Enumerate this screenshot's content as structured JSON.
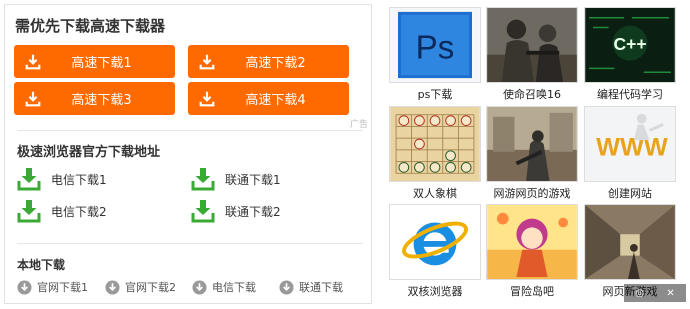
{
  "fast_download": {
    "title": "需优先下载高速下载器",
    "buttons": [
      "高速下载1",
      "高速下载2",
      "高速下载3",
      "高速下载4"
    ],
    "ad_label": "广告",
    "button_color": "#ff6a00"
  },
  "browser_download": {
    "title": "极速浏览器官方下载地址",
    "links": [
      "电信下载1",
      "联通下载1",
      "电信下载2",
      "联通下载2"
    ],
    "icon_color": "#3aa935"
  },
  "local_download": {
    "title": "本地下载",
    "links": [
      "官网下载1",
      "官网下载2",
      "电信下载",
      "联通下载"
    ]
  },
  "recommendations": [
    {
      "label": "ps下载",
      "icon": "photoshop-icon"
    },
    {
      "label": "使命召唤16",
      "icon": "soldier-image"
    },
    {
      "label": "编程代码学习",
      "icon": "cpp-code-image"
    },
    {
      "label": "双人象棋",
      "icon": "chess-board-image"
    },
    {
      "label": "网游网页的游戏",
      "icon": "game-scene-image"
    },
    {
      "label": "创建网站",
      "icon": "www-image"
    },
    {
      "label": "双核浏览器",
      "icon": "browser-logo-icon"
    },
    {
      "label": "冒险岛吧",
      "icon": "cartoon-character-image"
    },
    {
      "label": "网页新游戏",
      "icon": "game-corridor-image"
    }
  ],
  "overlay": {
    "left": "◎",
    "right": "✕"
  },
  "ps_text": "Ps",
  "cpp_text": "C++",
  "www_text": "WWW"
}
